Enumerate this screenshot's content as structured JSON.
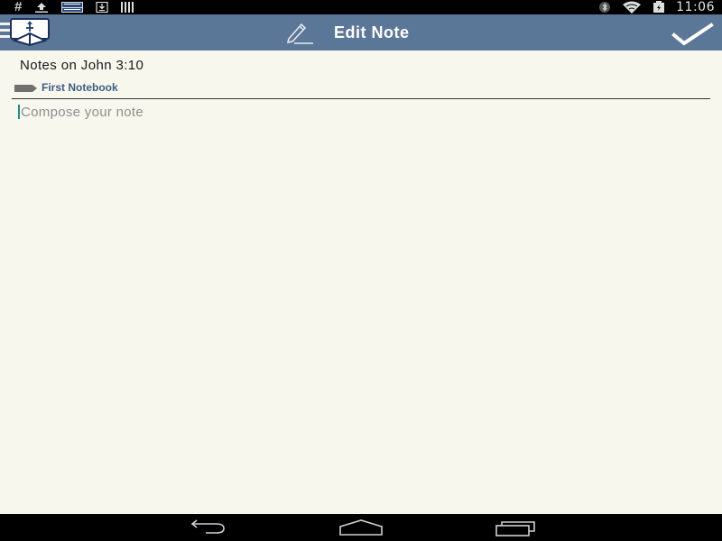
{
  "status_bar": {
    "left_icons": [
      "hash-icon",
      "upload-icon",
      "news-app-icon",
      "download-icon",
      "barcode-icon"
    ],
    "right_icons": [
      "bluetooth-icon",
      "wifi-icon",
      "battery-icon"
    ],
    "hash_glyph": "#",
    "time": "11:06"
  },
  "action_bar": {
    "logo": "bible-app-logo-icon",
    "title_icon": "pencil-icon",
    "title": "Edit Note",
    "confirm_icon": "checkmark-icon"
  },
  "note": {
    "title": "Notes on John 3:10",
    "notebook_icon": "tag-icon",
    "notebook_name": "First Notebook",
    "body_value": "",
    "body_placeholder": "Compose your note"
  },
  "nav_bar": {
    "buttons": [
      "back-icon",
      "home-icon",
      "recent-apps-icon"
    ]
  },
  "colors": {
    "status_bar": "#000000",
    "action_bar": "#5a7797",
    "background": "#f7f7ed",
    "notebook_label": "#3f5e86",
    "cursor": "#1e8f8a",
    "nav_bar": "#000000"
  }
}
